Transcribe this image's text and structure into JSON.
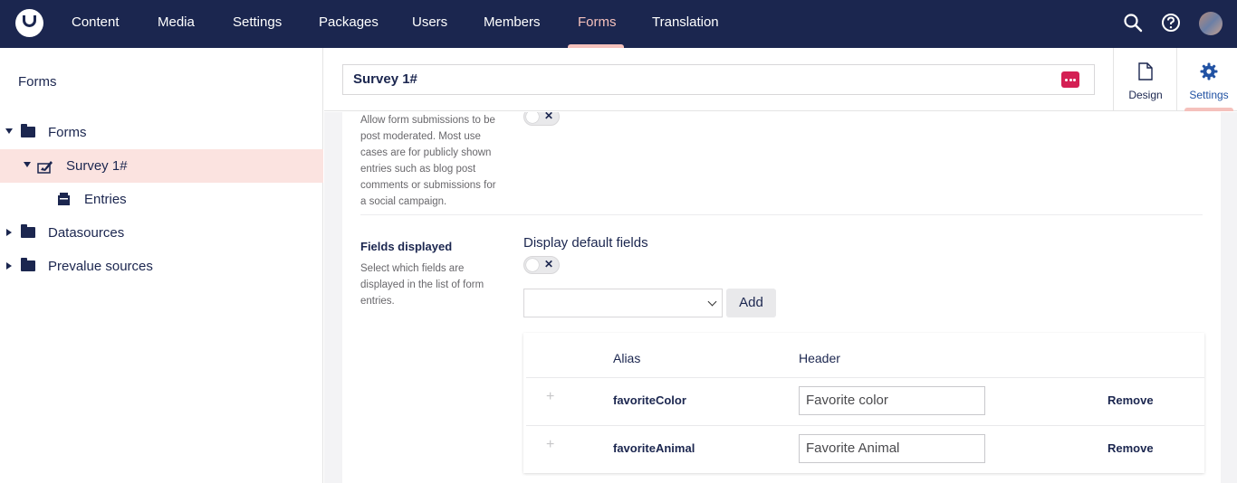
{
  "topnav": {
    "items": [
      "Content",
      "Media",
      "Settings",
      "Packages",
      "Users",
      "Members",
      "Forms",
      "Translation"
    ],
    "active": "Forms",
    "icons": [
      "search-icon",
      "help-icon",
      "user-avatar"
    ]
  },
  "sidebar": {
    "title": "Forms",
    "tree": [
      {
        "label": "Forms",
        "expanded": true
      },
      {
        "label": "Survey 1#",
        "expanded": true,
        "selected": true
      },
      {
        "label": "Entries"
      },
      {
        "label": "Datasources",
        "expanded": false
      },
      {
        "label": "Prevalue sources",
        "expanded": false
      }
    ]
  },
  "editor": {
    "name": "Survey 1#",
    "tabs": [
      "Design",
      "Settings"
    ],
    "active_tab": "Settings"
  },
  "settings": {
    "moderation_desc": "Allow form submissions to be post moderated. Most use cases are for publicly shown entries such as blog post comments or submissions for a social campaign.",
    "moderation_desc_lines": [
      "Allow form submissions to be",
      "post moderated. Most use",
      "cases are for publicly shown",
      "entries such as blog post",
      "comments or submissions for",
      "a social campaign."
    ],
    "fields_label": "Fields displayed",
    "fields_desc_lines": [
      "Select which fields are",
      "displayed in the list of form",
      "entries."
    ],
    "display_default_label": "Display default fields",
    "add_label": "Add",
    "table": {
      "headers": [
        "Alias",
        "Header"
      ],
      "rows": [
        {
          "alias": "favoriteColor",
          "header": "Favorite color",
          "action": "Remove"
        },
        {
          "alias": "favoriteAnimal",
          "header": "Favorite Animal",
          "action": "Remove"
        }
      ]
    }
  },
  "colors": {
    "nav_bg": "#1b264f",
    "accent": "#f5c1bc",
    "danger": "#d42054",
    "selected_row": "#fbe3e0"
  }
}
